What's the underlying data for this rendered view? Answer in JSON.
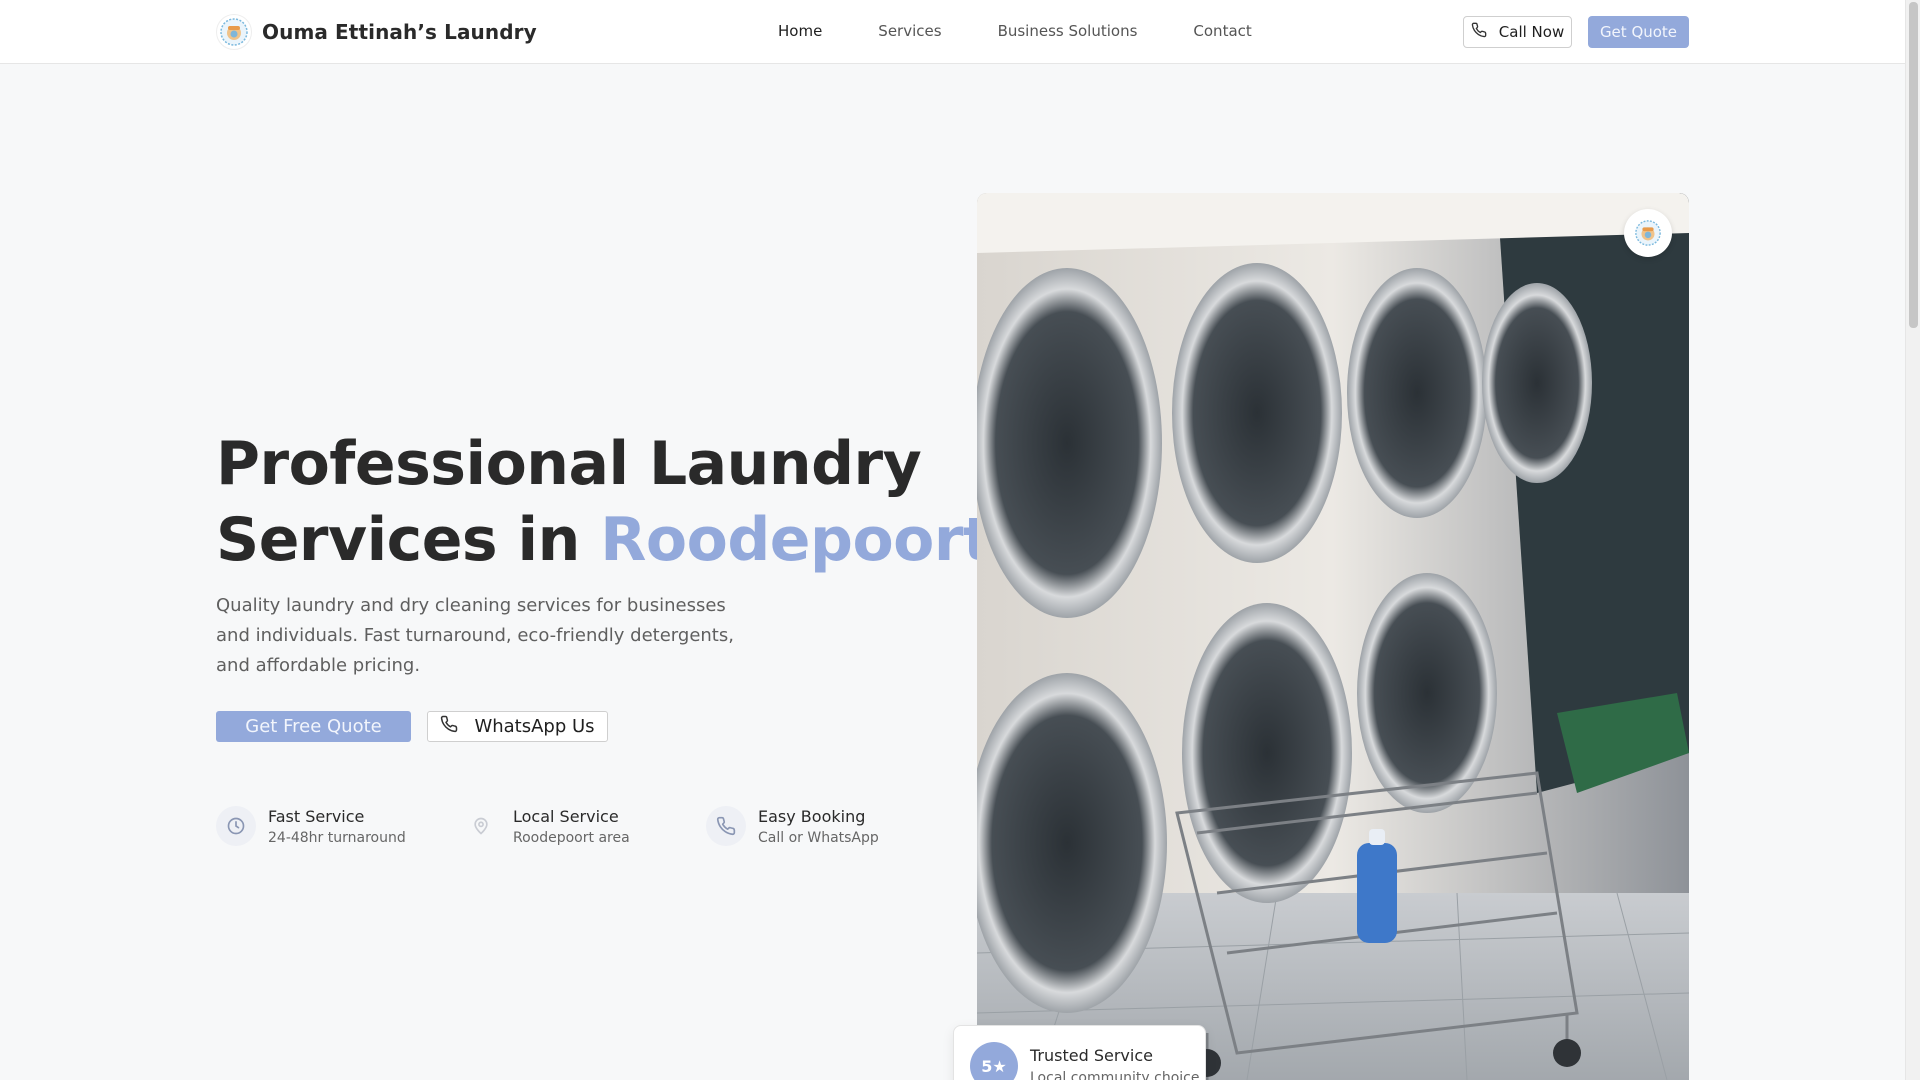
{
  "header": {
    "brand_name": "Ouma Ettinah’s Laundry",
    "nav": [
      {
        "label": "Home",
        "active": true
      },
      {
        "label": "Services",
        "active": false
      },
      {
        "label": "Business Solutions",
        "active": false
      },
      {
        "label": "Contact",
        "active": false
      }
    ],
    "call_label": "Call Now",
    "quote_label": "Get Quote"
  },
  "hero": {
    "title_line1": "Professional Laundry",
    "title_line2_prefix": "Services in ",
    "title_line2_accent": "Roodepoort",
    "subtitle": "Quality laundry and dry cleaning services for businesses and individuals. Fast turnaround, eco-friendly detergents, and affordable pricing.",
    "primary_btn": "Get Free Quote",
    "secondary_btn": "WhatsApp Us"
  },
  "features": [
    {
      "title": "Fast Service",
      "sub": "24-48hr turnaround",
      "icon": "clock-icon"
    },
    {
      "title": "Local Service",
      "sub": "Roodepoort area",
      "icon": "map-pin-icon"
    },
    {
      "title": "Easy Booking",
      "sub": "Call or WhatsApp",
      "icon": "phone-icon"
    }
  ],
  "trust": {
    "rating": "5★",
    "title": "Trusted Service",
    "sub": "Local community choice"
  },
  "colors": {
    "accent": "#93a9db",
    "text": "#2a2a2a"
  }
}
